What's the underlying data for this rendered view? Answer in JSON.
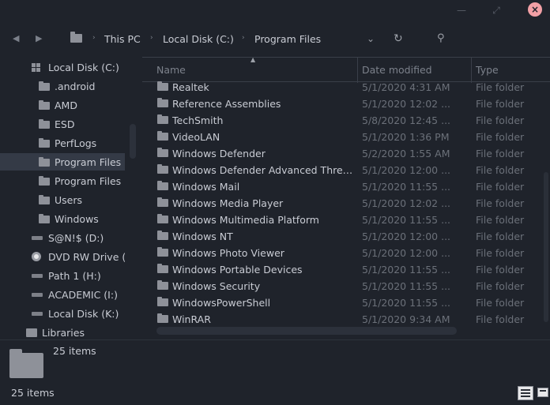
{
  "window": {
    "minimize_glyph": "—",
    "maximize_glyph": "⤢",
    "close_glyph": "×"
  },
  "address_bar": {
    "breadcrumbs": [
      "This PC",
      "Local Disk (C:)",
      "Program Files"
    ],
    "separator": "›"
  },
  "sidebar": {
    "items": [
      {
        "label": "Local Disk (C:)",
        "icon": "drive-grid-icon"
      },
      {
        "label": ".android",
        "icon": "folder-icon"
      },
      {
        "label": "AMD",
        "icon": "folder-icon"
      },
      {
        "label": "ESD",
        "icon": "folder-icon"
      },
      {
        "label": "PerfLogs",
        "icon": "folder-icon"
      },
      {
        "label": "Program Files",
        "icon": "folder-icon",
        "selected": true
      },
      {
        "label": "Program Files (",
        "icon": "folder-icon"
      },
      {
        "label": "Users",
        "icon": "folder-icon"
      },
      {
        "label": "Windows",
        "icon": "folder-icon"
      },
      {
        "label": "S@N!$ (D:)",
        "icon": "drive-icon"
      },
      {
        "label": "DVD RW Drive (",
        "icon": "disc-icon"
      },
      {
        "label": "Path 1 (H:)",
        "icon": "drive-icon"
      },
      {
        "label": "ACADEMIC (I:)",
        "icon": "drive-icon"
      },
      {
        "label": "Local Disk (K:)",
        "icon": "drive-icon"
      },
      {
        "label": "Libraries",
        "icon": "library-icon"
      }
    ]
  },
  "columns": {
    "name": "Name",
    "date": "Date modified",
    "type": "Type"
  },
  "files": [
    {
      "name": "Realtek",
      "date": "5/1/2020 4:31 AM",
      "type": "File folder"
    },
    {
      "name": "Reference Assemblies",
      "date": "5/1/2020 12:02 ...",
      "type": "File folder"
    },
    {
      "name": "TechSmith",
      "date": "5/8/2020 12:45 ...",
      "type": "File folder"
    },
    {
      "name": "VideoLAN",
      "date": "5/1/2020 1:36 PM",
      "type": "File folder"
    },
    {
      "name": "Windows Defender",
      "date": "5/2/2020 1:55 AM",
      "type": "File folder"
    },
    {
      "name": "Windows Defender Advanced Threa...",
      "date": "5/1/2020 12:00 ...",
      "type": "File folder"
    },
    {
      "name": "Windows Mail",
      "date": "5/1/2020 11:55 ...",
      "type": "File folder"
    },
    {
      "name": "Windows Media Player",
      "date": "5/1/2020 12:02 ...",
      "type": "File folder"
    },
    {
      "name": "Windows Multimedia Platform",
      "date": "5/1/2020 11:55 ...",
      "type": "File folder"
    },
    {
      "name": "Windows NT",
      "date": "5/1/2020 12:00 ...",
      "type": "File folder"
    },
    {
      "name": "Windows Photo Viewer",
      "date": "5/1/2020 12:00 ...",
      "type": "File folder"
    },
    {
      "name": "Windows Portable Devices",
      "date": "5/1/2020 11:55 ...",
      "type": "File folder"
    },
    {
      "name": "Windows Security",
      "date": "5/1/2020 11:55 ...",
      "type": "File folder"
    },
    {
      "name": "WindowsPowerShell",
      "date": "5/1/2020 11:55 ...",
      "type": "File folder"
    },
    {
      "name": "WinRAR",
      "date": "5/1/2020 9:34 AM",
      "type": "File folder"
    }
  ],
  "details": {
    "count_text": "25 items"
  },
  "status": {
    "count_text": "25 items"
  }
}
